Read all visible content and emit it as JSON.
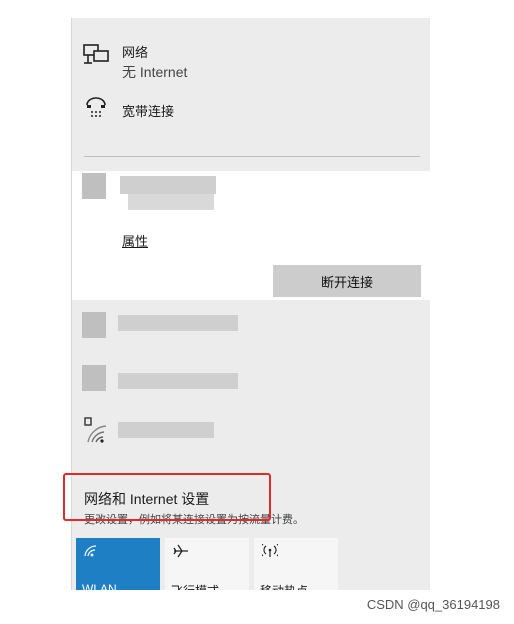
{
  "networks": {
    "ethernet": {
      "name": "网络",
      "status": "无 Internet",
      "icon": "ethernet-icon"
    },
    "broadband": {
      "name": "宽带连接",
      "icon": "dialup-icon"
    }
  },
  "selected": {
    "properties_label": "属性",
    "disconnect_label": "断开连接"
  },
  "settings": {
    "title": "网络和 Internet 设置",
    "subtitle": "更改设置，例如将某连接设置为按流量计费。"
  },
  "quick_actions": [
    {
      "label": "WLAN",
      "icon": "wifi-icon",
      "active": true
    },
    {
      "label": "飞行模式",
      "icon": "airplane-icon",
      "active": false
    },
    {
      "label": "移动热点",
      "icon": "hotspot-icon",
      "active": false
    }
  ],
  "watermark": "CSDN @qq_36194198",
  "colors": {
    "accent": "#1e7fc4",
    "highlight_border": "#e5282a",
    "panel": "#ececec"
  }
}
